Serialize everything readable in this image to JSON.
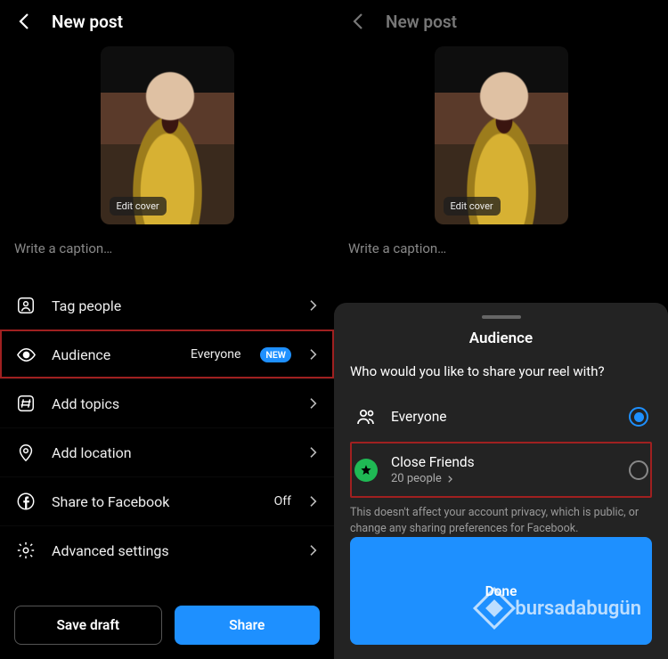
{
  "left": {
    "header": {
      "title": "New post"
    },
    "cover": {
      "edit_label": "Edit cover"
    },
    "caption_placeholder": "Write a caption…",
    "options": [
      {
        "key": "tag-people",
        "label": "Tag people"
      },
      {
        "key": "audience",
        "label": "Audience",
        "value": "Everyone",
        "badge": "NEW",
        "highlighted": true
      },
      {
        "key": "add-topics",
        "label": "Add topics"
      },
      {
        "key": "add-location",
        "label": "Add location"
      },
      {
        "key": "share-fb",
        "label": "Share to Facebook",
        "value": "Off"
      },
      {
        "key": "advanced",
        "label": "Advanced settings"
      }
    ],
    "buttons": {
      "draft": "Save draft",
      "share": "Share"
    }
  },
  "right": {
    "header": {
      "title": "New post"
    },
    "cover": {
      "edit_label": "Edit cover"
    },
    "caption_placeholder": "Write a caption…",
    "sheet": {
      "title": "Audience",
      "subtitle": "Who would you like to share your reel with?",
      "options": [
        {
          "key": "everyone",
          "title": "Everyone",
          "selected": true
        },
        {
          "key": "close-friends",
          "title": "Close Friends",
          "sub": "20 people",
          "highlighted": true
        }
      ],
      "note": "This doesn't affect your account privacy, which is public, or change any sharing preferences for Facebook.",
      "done": "Done"
    }
  },
  "watermark": "bursadabugün"
}
